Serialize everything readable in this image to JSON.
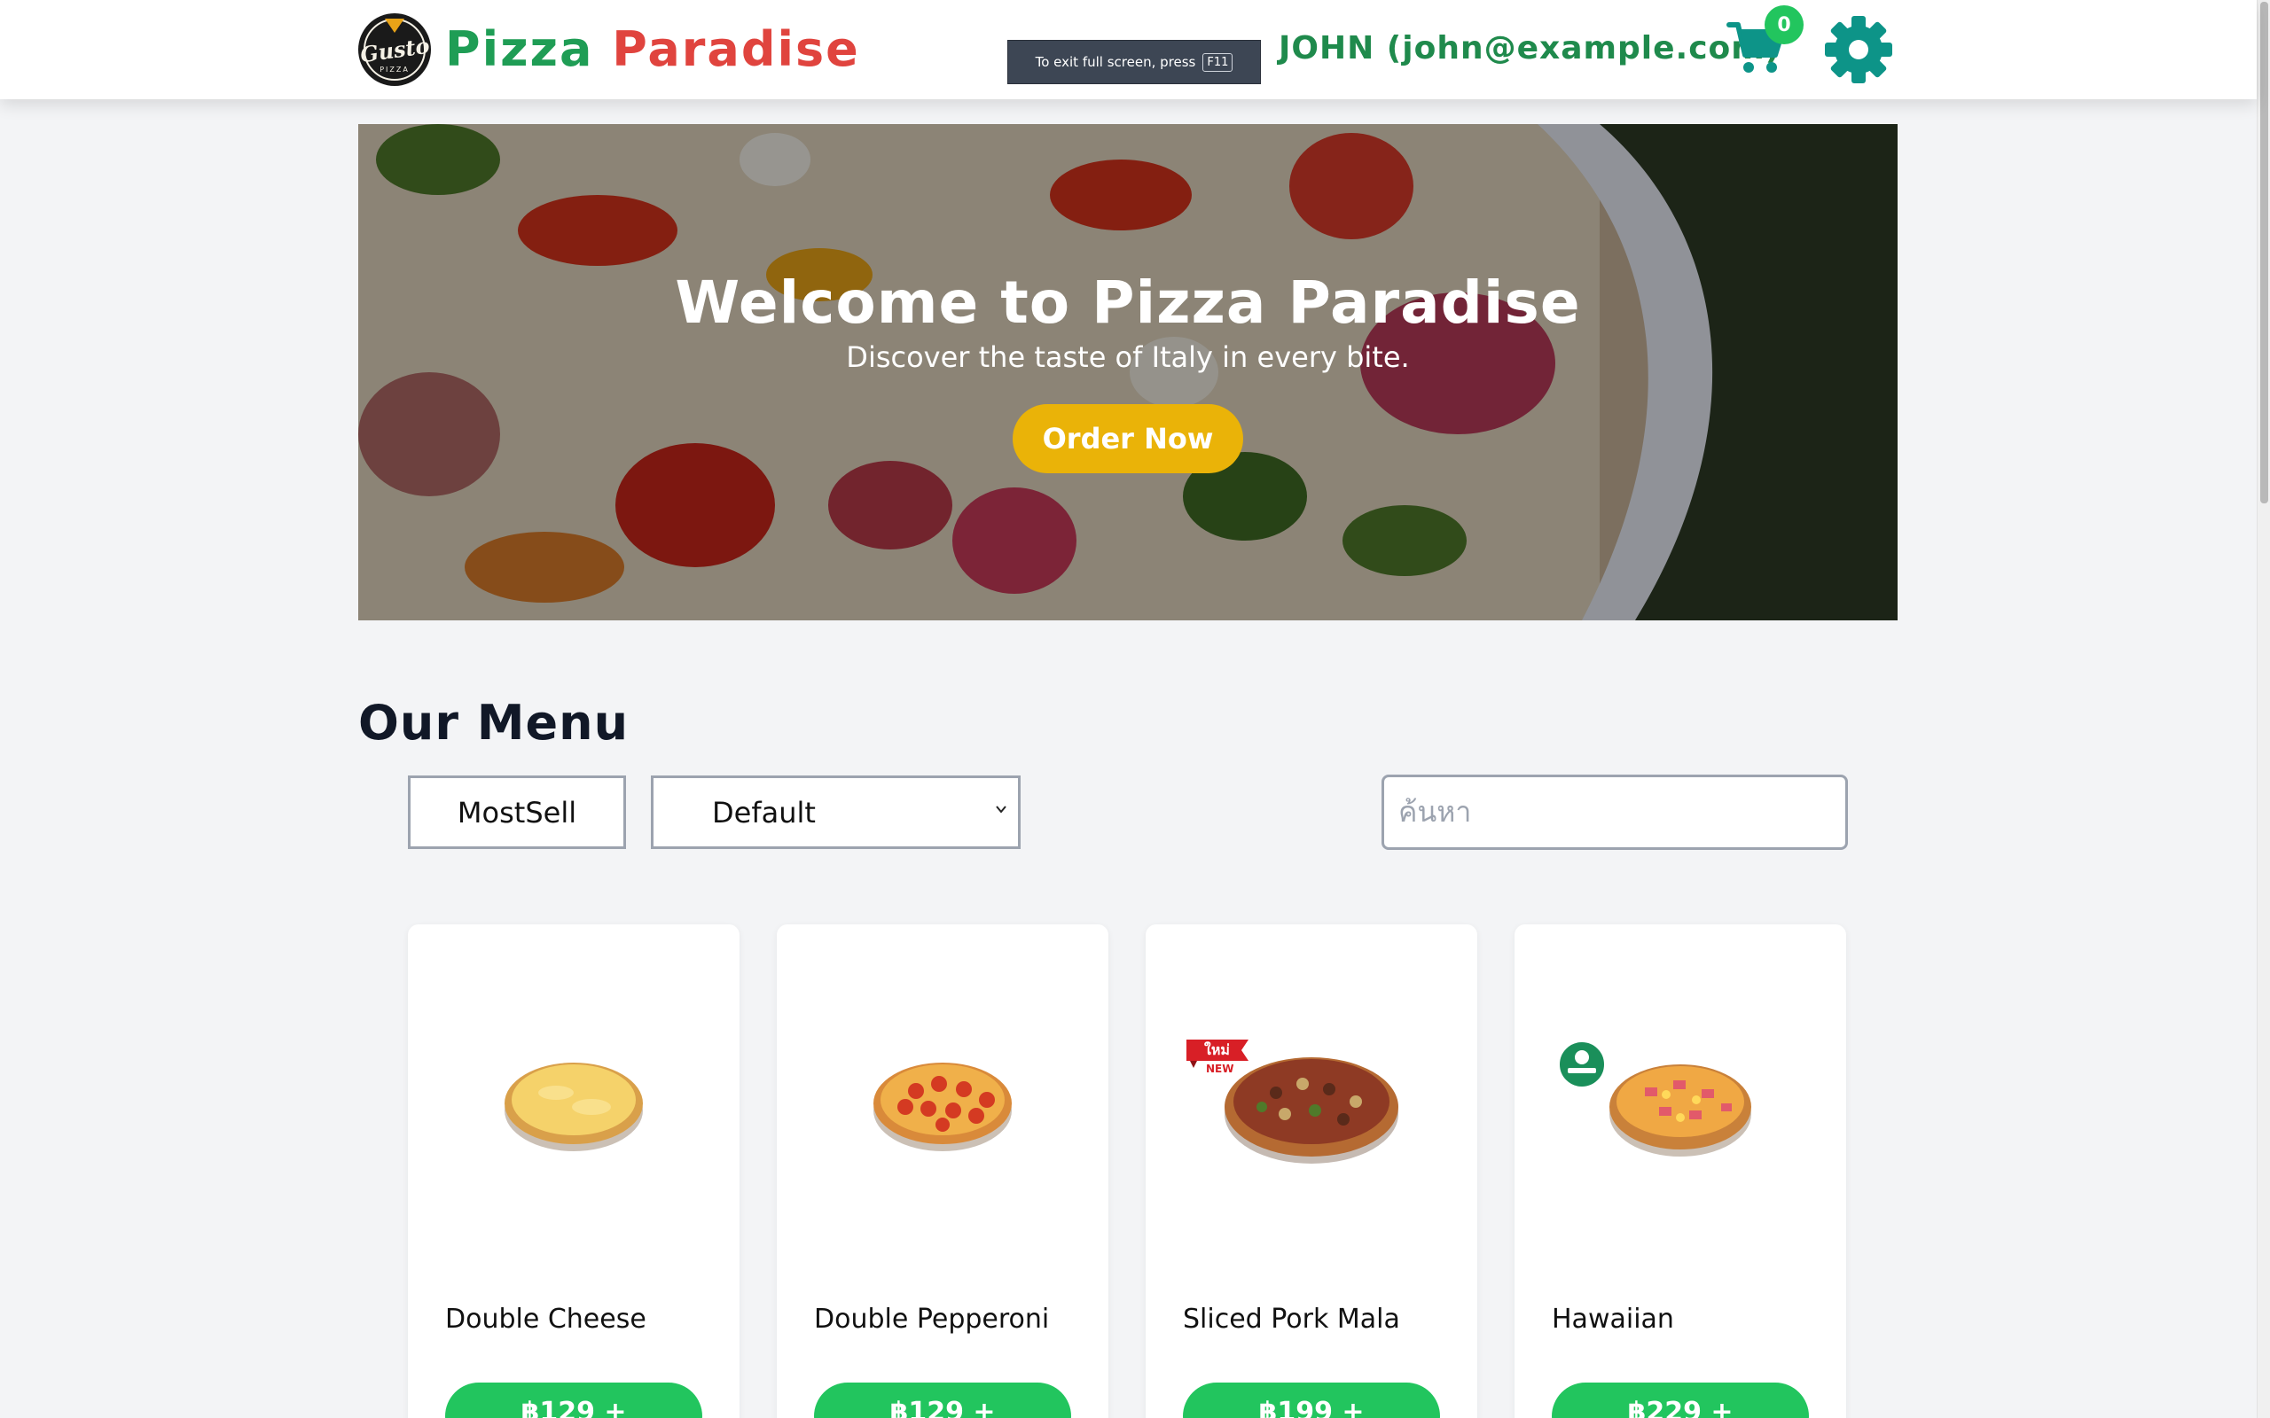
{
  "header": {
    "logo_text": "Gusto",
    "logo_sub": "PIZZA",
    "brand_word1": "Pizza",
    "brand_word2": "Paradise",
    "user_label": "JOHN (john@example.com)",
    "cart_count": "0",
    "icons": {
      "cart": "cart-icon",
      "settings": "gear-icon"
    },
    "colors": {
      "brand_green": "#1f9d55",
      "brand_red": "#e0443e",
      "teal": "#0d9488",
      "badge": "#22c55e"
    }
  },
  "fullscreen_toast": {
    "text": "To exit full screen, press",
    "key": "F11"
  },
  "hero": {
    "title": "Welcome to Pizza Paradise",
    "subtitle": "Discover the taste of Italy in every bite.",
    "cta_label": "Order Now",
    "cta_color": "#eab308"
  },
  "menu": {
    "title": "Our Menu",
    "filter_button": "MostSell",
    "sort_selected": "Default",
    "search_placeholder": "ค้นหา",
    "items": [
      {
        "name": "Double Cheese",
        "price": "฿129 +",
        "badge": ""
      },
      {
        "name": "Double Pepperoni",
        "price": "฿129 +",
        "badge": ""
      },
      {
        "name": "Sliced Pork Mala",
        "price": "฿199 +",
        "badge_main": "ใหม่",
        "badge_sub": "NEW"
      },
      {
        "name": "Hawaiian",
        "price": "฿229 +",
        "badge": ""
      }
    ],
    "button_color": "#22c55e"
  }
}
